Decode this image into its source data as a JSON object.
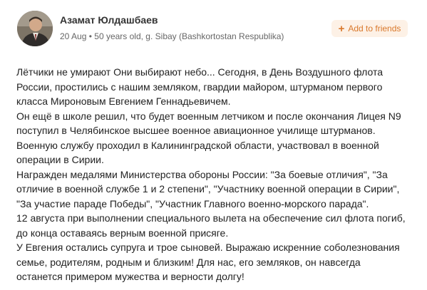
{
  "author": {
    "name": "Азамат Юлдашбаев",
    "date": "20 Aug",
    "separator": "•",
    "details": "50 years old, g. Sibay (Bashkortostan Respublika)"
  },
  "actions": {
    "add_friend_icon": "plus-icon",
    "add_friend_label": "Add to friends"
  },
  "post": {
    "lines": [
      "Лётчики не умирают Они выбирают небо... Сегодня, в День Воздушного флота",
      "России, простились с нашим земляком, гвардии майором, штурманом первого",
      "класса Мироновым Евгением Геннадьевичем.",
      "Он ещё в школе решил, что будет военным летчиком и после окончания Лицея N9",
      "поступил в Челябинское высшее военное авиационное училище штурманов.",
      "Военную службу проходил в Калининградской области, участвовал в военной",
      "операции в Сирии.",
      "Награжден медалями Министерства обороны России: \"За боевые отличия\", \"За",
      "отличие в военной службе 1 и 2 степени\", \"Участнику военной операции в Сирии\",",
      "\"За участие параде Победы\", \"Участник Главного военно-морского парада\".",
      "12 августа при выполнении специального вылета на обеспечение сил флота погиб,",
      "до конца оставаясь верным военной присяге.",
      "У Евгения остались супруга и трое сыновей. Выражаю искренние соболезнования",
      "семье, родителям, родным и близким! Для нас, его земляков, он навсегда",
      "останется примером мужества и верности долгу!"
    ]
  },
  "colors": {
    "accent": "#d9782b",
    "button_bg": "#fdf1e6",
    "text": "#222222",
    "meta": "#666666"
  }
}
